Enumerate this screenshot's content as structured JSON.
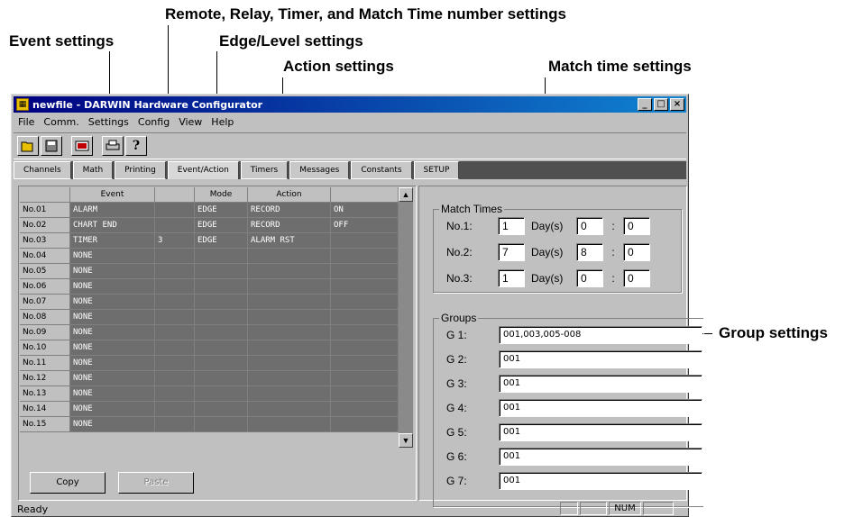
{
  "annotations": {
    "remote": "Remote, Relay, Timer, and Match Time number settings",
    "event": "Event settings",
    "edge": "Edge/Level settings",
    "action": "Action settings",
    "match": "Match time settings",
    "group": "Group settings"
  },
  "window": {
    "title": "newfile - DARWIN Hardware Configurator",
    "min": "_",
    "max": "□",
    "close": "×"
  },
  "menu": [
    "File",
    "Comm.",
    "Settings",
    "Config",
    "View",
    "Help"
  ],
  "toolbar_icons": [
    "open-icon",
    "save-icon",
    "transfer-icon",
    "print-icon",
    "help-icon"
  ],
  "tabs": [
    "Channels",
    "Math",
    "Printing",
    "Event/Action",
    "Timers",
    "Messages",
    "Constants",
    "SETUP"
  ],
  "active_tab": "Event/Action",
  "grid": {
    "headers": [
      "",
      "Event",
      "",
      "Mode",
      "Action",
      ""
    ],
    "rows": [
      {
        "no": "No.01",
        "event": "ALARM",
        "num": "",
        "mode": "EDGE",
        "action": "RECORD",
        "onoff": "ON"
      },
      {
        "no": "No.02",
        "event": "CHART END",
        "num": "",
        "mode": "EDGE",
        "action": "RECORD",
        "onoff": "OFF"
      },
      {
        "no": "No.03",
        "event": "TIMER",
        "num": "3",
        "mode": "EDGE",
        "action": "ALARM RST",
        "onoff": ""
      },
      {
        "no": "No.04",
        "event": "NONE",
        "num": "",
        "mode": "",
        "action": "",
        "onoff": ""
      },
      {
        "no": "No.05",
        "event": "NONE",
        "num": "",
        "mode": "",
        "action": "",
        "onoff": ""
      },
      {
        "no": "No.06",
        "event": "NONE",
        "num": "",
        "mode": "",
        "action": "",
        "onoff": ""
      },
      {
        "no": "No.07",
        "event": "NONE",
        "num": "",
        "mode": "",
        "action": "",
        "onoff": ""
      },
      {
        "no": "No.08",
        "event": "NONE",
        "num": "",
        "mode": "",
        "action": "",
        "onoff": ""
      },
      {
        "no": "No.09",
        "event": "NONE",
        "num": "",
        "mode": "",
        "action": "",
        "onoff": ""
      },
      {
        "no": "No.10",
        "event": "NONE",
        "num": "",
        "mode": "",
        "action": "",
        "onoff": ""
      },
      {
        "no": "No.11",
        "event": "NONE",
        "num": "",
        "mode": "",
        "action": "",
        "onoff": ""
      },
      {
        "no": "No.12",
        "event": "NONE",
        "num": "",
        "mode": "",
        "action": "",
        "onoff": ""
      },
      {
        "no": "No.13",
        "event": "NONE",
        "num": "",
        "mode": "",
        "action": "",
        "onoff": ""
      },
      {
        "no": "No.14",
        "event": "NONE",
        "num": "",
        "mode": "",
        "action": "",
        "onoff": ""
      },
      {
        "no": "No.15",
        "event": "NONE",
        "num": "",
        "mode": "",
        "action": "",
        "onoff": ""
      }
    ]
  },
  "buttons": {
    "copy": "Copy",
    "paste": "Paste"
  },
  "match_times": {
    "legend": "Match Times",
    "day_label": "Day(s)",
    "colon": ":",
    "rows": [
      {
        "label": "No.1:",
        "day": "1",
        "hour": "0",
        "min": "0"
      },
      {
        "label": "No.2:",
        "day": "7",
        "hour": "8",
        "min": "0"
      },
      {
        "label": "No.3:",
        "day": "1",
        "hour": "0",
        "min": "0"
      }
    ]
  },
  "groups": {
    "legend": "Groups",
    "rows": [
      {
        "label": "G 1:",
        "value": "001,003,005-008"
      },
      {
        "label": "G 2:",
        "value": "001"
      },
      {
        "label": "G 3:",
        "value": "001"
      },
      {
        "label": "G 4:",
        "value": "001"
      },
      {
        "label": "G 5:",
        "value": "001"
      },
      {
        "label": "G 6:",
        "value": "001"
      },
      {
        "label": "G 7:",
        "value": "001"
      }
    ]
  },
  "status": {
    "text": "Ready",
    "num": "NUM"
  }
}
